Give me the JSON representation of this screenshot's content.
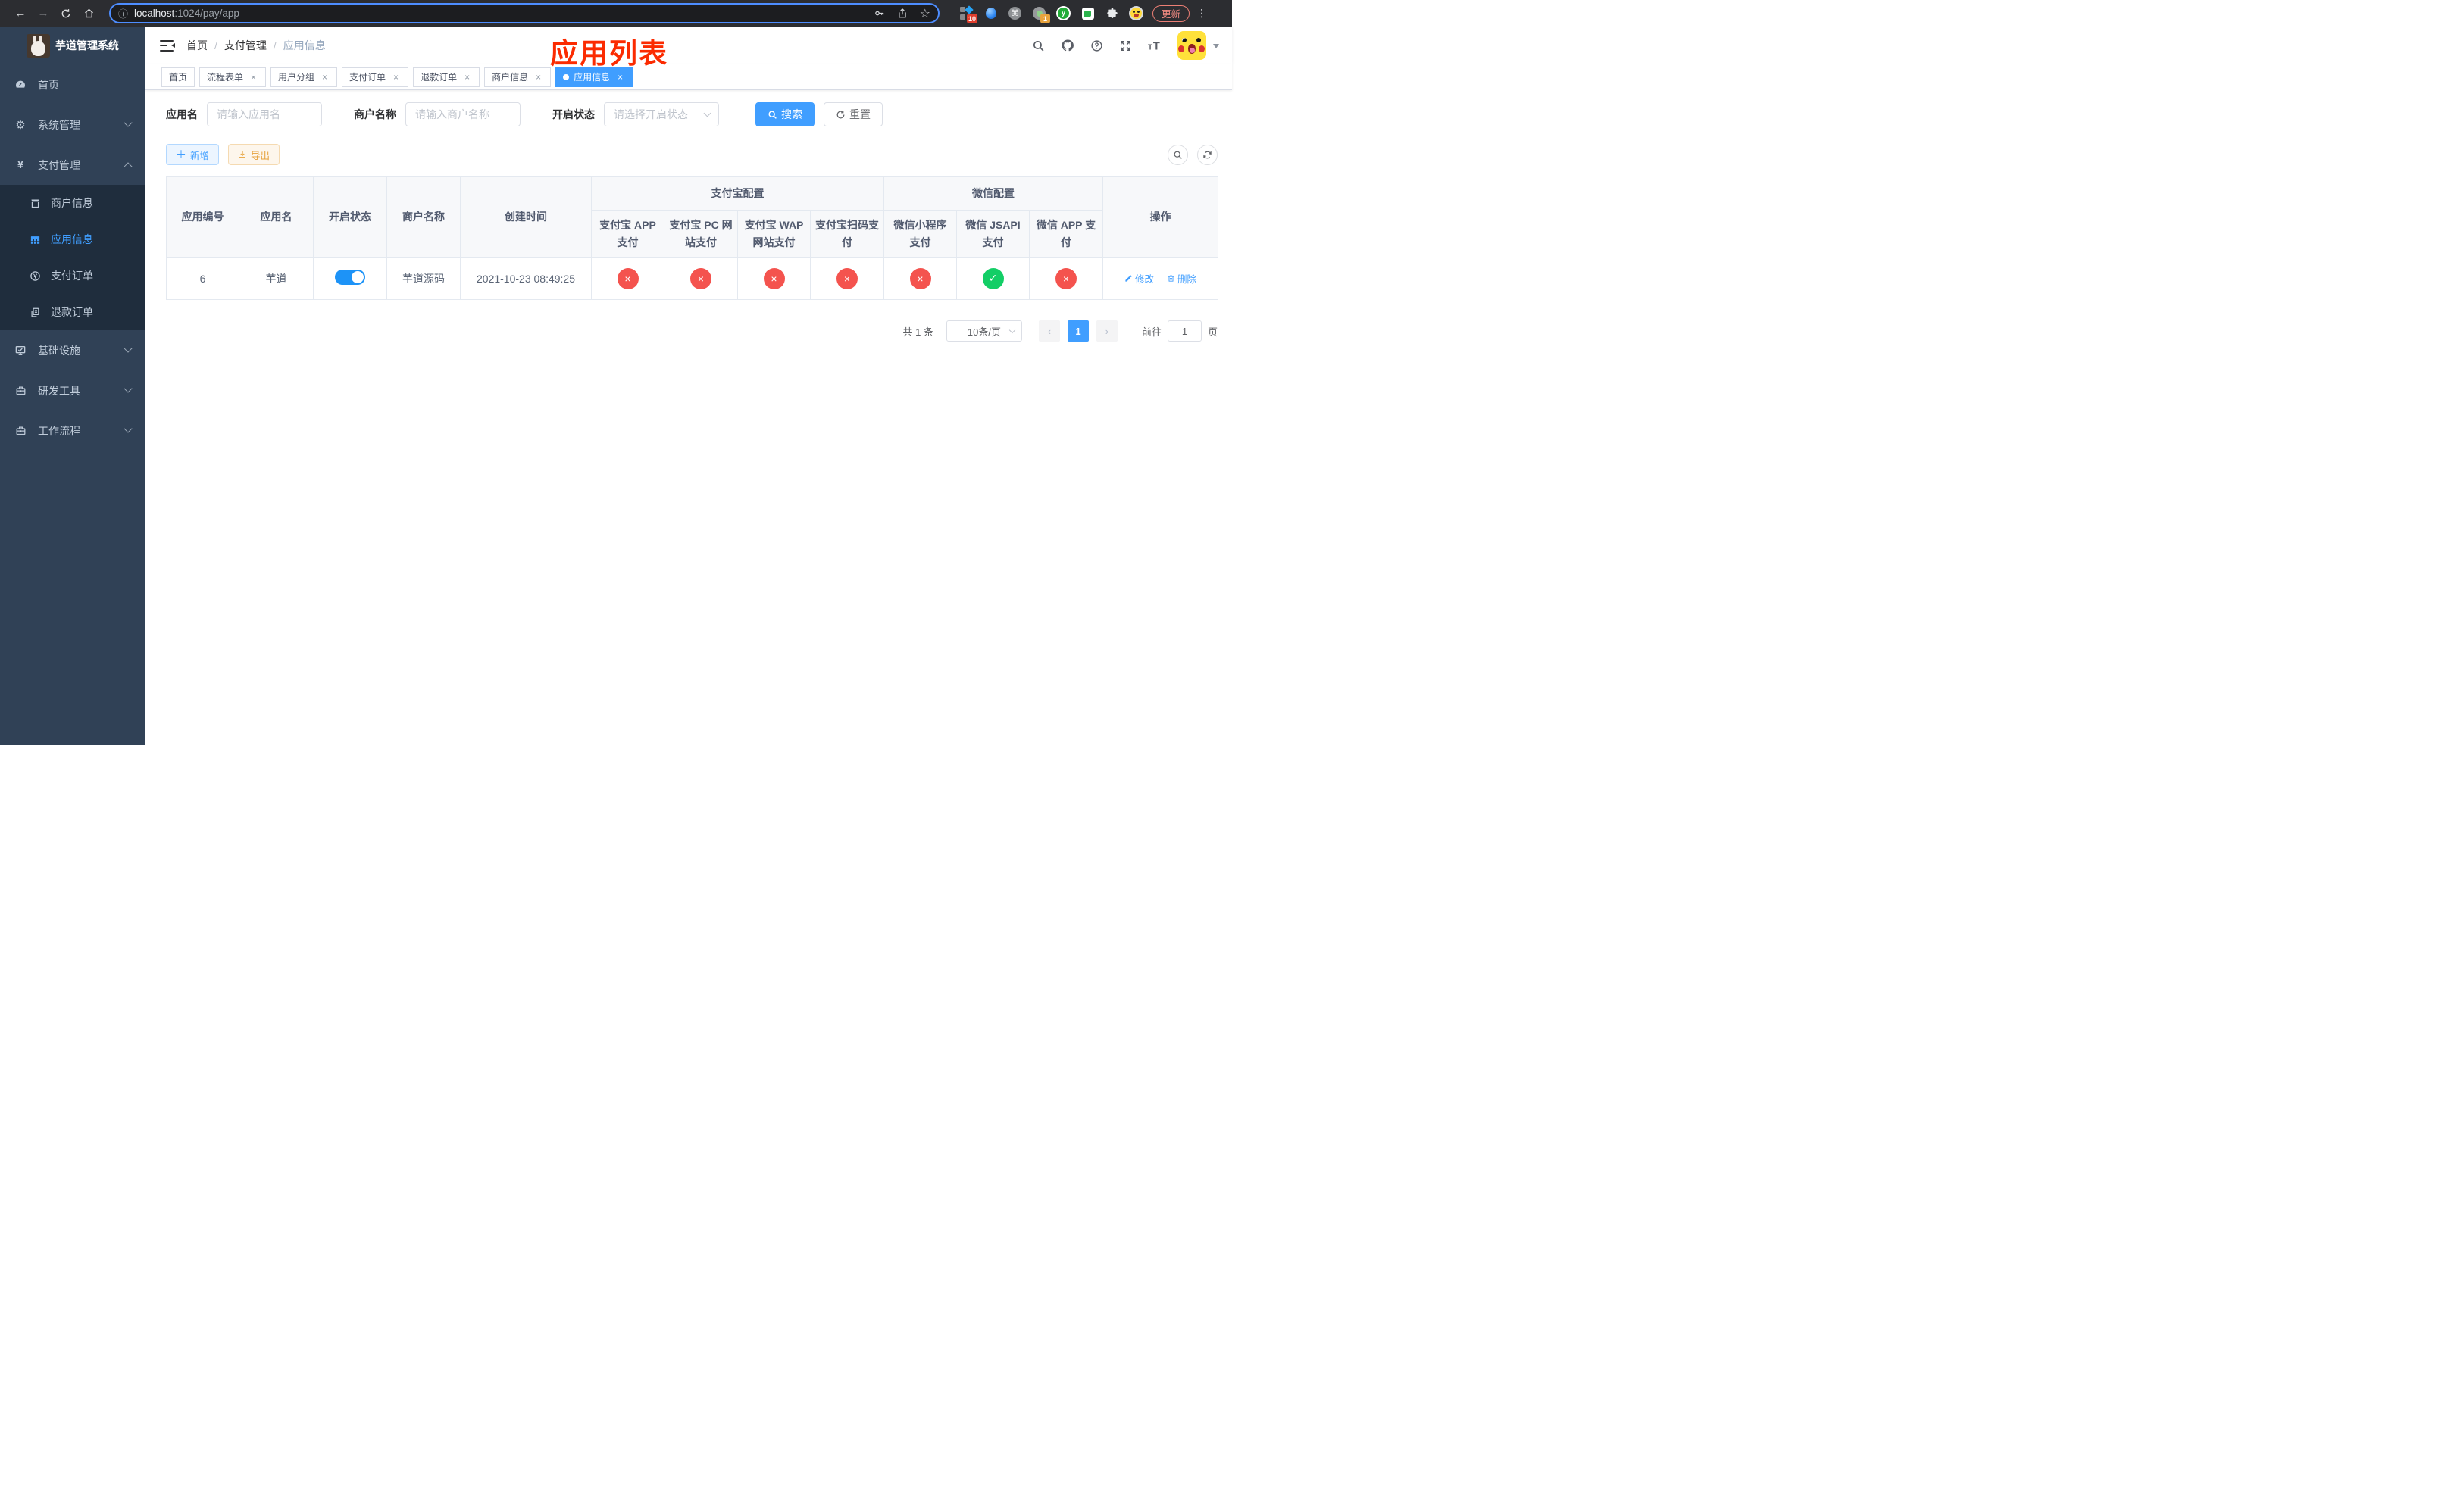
{
  "browser": {
    "url_host": "localhost",
    "url_rest": ":1024/pay/app",
    "update_label": "更新",
    "ext_badge_tamper": "10",
    "ext_badge_target": "1"
  },
  "sidebar": {
    "title": "芋道管理系统",
    "menu": [
      {
        "label": "首页"
      },
      {
        "label": "系统管理"
      },
      {
        "label": "支付管理"
      },
      {
        "label": "商户信息"
      },
      {
        "label": "应用信息"
      },
      {
        "label": "支付订单"
      },
      {
        "label": "退款订单"
      },
      {
        "label": "基础设施"
      },
      {
        "label": "研发工具"
      },
      {
        "label": "工作流程"
      }
    ]
  },
  "header": {
    "breadcrumb": [
      "首页",
      "支付管理",
      "应用信息"
    ],
    "annotation": "应用列表"
  },
  "tabs": [
    {
      "label": "首页"
    },
    {
      "label": "流程表单"
    },
    {
      "label": "用户分组"
    },
    {
      "label": "支付订单"
    },
    {
      "label": "退款订单"
    },
    {
      "label": "商户信息"
    },
    {
      "label": "应用信息"
    }
  ],
  "filters": {
    "app_name_label": "应用名",
    "app_name_placeholder": "请输入应用名",
    "merchant_label": "商户名称",
    "merchant_placeholder": "请输入商户名称",
    "status_label": "开启状态",
    "status_placeholder": "请选择开启状态",
    "search_label": "搜索",
    "reset_label": "重置"
  },
  "toolbar": {
    "add_label": "新增",
    "export_label": "导出"
  },
  "table": {
    "groups": {
      "alipay": "支付宝配置",
      "wechat": "微信配置"
    },
    "columns": [
      "应用编号",
      "应用名",
      "开启状态",
      "商户名称",
      "创建时间",
      "支付宝 APP 支付",
      "支付宝 PC 网站支付",
      "支付宝 WAP 网站支付",
      "支付宝扫码支付",
      "微信小程序支付",
      "微信 JSAPI 支付",
      "微信 APP 支付",
      "操作"
    ],
    "row": {
      "id": "6",
      "name": "芋道",
      "enabled": true,
      "merchant": "芋道源码",
      "created_at": "2021-10-23 08:49:25",
      "statuses": [
        "no",
        "no",
        "no",
        "no",
        "no",
        "yes",
        "no"
      ],
      "edit_label": "修改",
      "delete_label": "删除"
    }
  },
  "pagination": {
    "total": "共 1 条",
    "size": "10条/页",
    "page": "1",
    "goto_label": "前往",
    "goto_value": "1",
    "unit_label": "页"
  },
  "colors": {
    "accent": "#409eff",
    "danger": "#f4534e",
    "success": "#13ce66",
    "sidebar": "#304156"
  }
}
